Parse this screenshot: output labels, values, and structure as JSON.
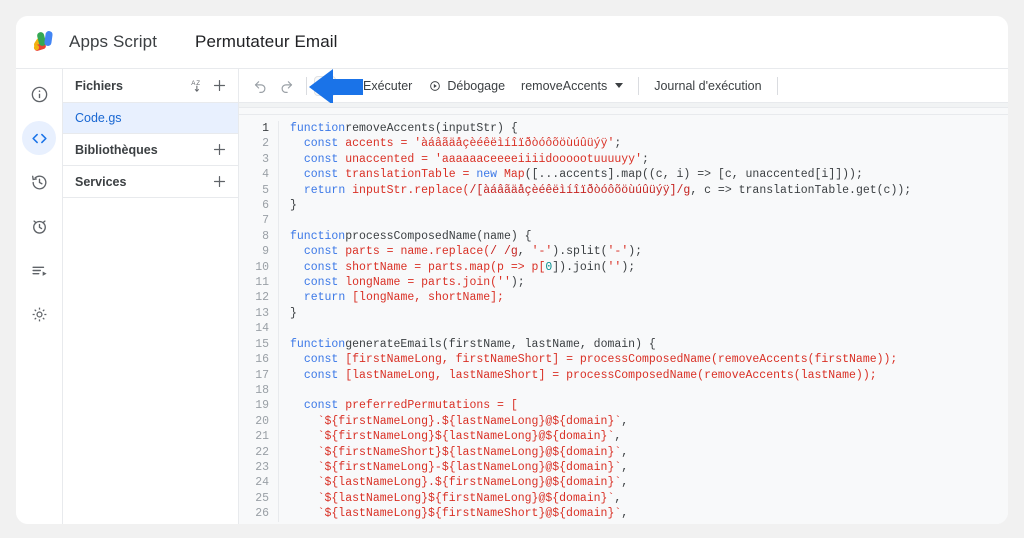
{
  "header": {
    "logo_icon": "apps-script-logo",
    "app_name": "Apps Script",
    "project_title": "Permutateur Email"
  },
  "rail": {
    "items": [
      {
        "icon": "info-icon",
        "label": "Présentation"
      },
      {
        "icon": "code-icon",
        "label": "Éditeur"
      },
      {
        "icon": "history-icon",
        "label": "Historique"
      },
      {
        "icon": "alarm-clock-icon",
        "label": "Déclencheurs"
      },
      {
        "icon": "executions-list-icon",
        "label": "Exécutions"
      },
      {
        "icon": "gear-icon",
        "label": "Paramètres du projet"
      }
    ],
    "active_index": 1
  },
  "files_panel": {
    "sections": [
      {
        "label": "Fichiers",
        "sort_icon": "sort-az-icon",
        "add_icon": "plus-icon"
      },
      {
        "label": "Bibliothèques",
        "add_icon": "plus-icon"
      },
      {
        "label": "Services",
        "add_icon": "plus-icon"
      }
    ],
    "files": [
      {
        "name": "Code.gs",
        "selected": true
      }
    ]
  },
  "toolbar": {
    "undo_icon": "undo-icon",
    "redo_icon": "redo-icon",
    "save_icon": "save-floppy-icon",
    "run_label": "Exécuter",
    "run_icon": "play-icon",
    "debug_label": "Débogage",
    "debug_icon": "debug-icon",
    "function_selector": "removeAccents",
    "log_label": "Journal d'exécution",
    "annotation_arrow": "left-arrow-annotation",
    "annotation_color": "#1a73e8"
  },
  "code": {
    "language": "javascript",
    "first_line": 1,
    "last_line": 26,
    "lines": [
      {
        "n": 1,
        "tokens": [
          [
            "kw",
            "function"
          ],
          [
            "",
            ""
          ],
          [
            "fn",
            "removeAccents"
          ],
          [
            "",
            "(inputStr) {"
          ]
        ]
      },
      {
        "n": 2,
        "tokens": [
          [
            "",
            "  "
          ],
          [
            "kw",
            "const"
          ],
          [
            "at",
            " accents = "
          ],
          [
            "str",
            "'àáâãäåçèéêëìíîïðòóôõöùúûüýÿ'"
          ],
          [
            "",
            ";"
          ]
        ]
      },
      {
        "n": 3,
        "tokens": [
          [
            "",
            "  "
          ],
          [
            "kw",
            "const"
          ],
          [
            "at",
            " unaccented = "
          ],
          [
            "str",
            "'aaaaaaceeeeiiiidoooootuuuuyy'"
          ],
          [
            "",
            ";"
          ]
        ]
      },
      {
        "n": 4,
        "tokens": [
          [
            "",
            "  "
          ],
          [
            "kw",
            "const"
          ],
          [
            "at",
            " translationTable = "
          ],
          [
            "kw",
            "new"
          ],
          [
            "cls",
            " Map"
          ],
          [
            "",
            "([...accents].map((c, i) => [c, unaccented[i]]));"
          ]
        ]
      },
      {
        "n": 5,
        "tokens": [
          [
            "",
            "  "
          ],
          [
            "kw",
            "return"
          ],
          [
            "at",
            " inputStr.replace("
          ],
          [
            "re",
            "/[àáâãäåçèéêëìíîïðòóôõöùúûüýÿ]/g"
          ],
          [
            "",
            ", c => translationTable.get(c));"
          ]
        ]
      },
      {
        "n": 6,
        "tokens": [
          [
            "",
            "}"
          ]
        ]
      },
      {
        "n": 7,
        "tokens": [
          [
            "",
            ""
          ]
        ]
      },
      {
        "n": 8,
        "tokens": [
          [
            "kw",
            "function"
          ],
          [
            "",
            ""
          ],
          [
            "fn",
            "processComposedName"
          ],
          [
            "",
            "(name) {"
          ]
        ]
      },
      {
        "n": 9,
        "tokens": [
          [
            "",
            "  "
          ],
          [
            "kw",
            "const"
          ],
          [
            "at",
            " parts = name.replace("
          ],
          [
            "re",
            "/ /g"
          ],
          [
            "",
            ", "
          ],
          [
            "str",
            "'-'"
          ],
          [
            "",
            ").split("
          ],
          [
            "str",
            "'-'"
          ],
          [
            "",
            ");"
          ]
        ]
      },
      {
        "n": 10,
        "tokens": [
          [
            "",
            "  "
          ],
          [
            "kw",
            "const"
          ],
          [
            "at",
            " shortName = parts.map(p => p["
          ],
          [
            "num",
            "0"
          ],
          [
            "",
            "]).join("
          ],
          [
            "str",
            "''"
          ],
          [
            "",
            ");"
          ]
        ]
      },
      {
        "n": 11,
        "tokens": [
          [
            "",
            "  "
          ],
          [
            "kw",
            "const"
          ],
          [
            "at",
            " longName = parts.join("
          ],
          [
            "str",
            "''"
          ],
          [
            "",
            ");"
          ]
        ]
      },
      {
        "n": 12,
        "tokens": [
          [
            "",
            "  "
          ],
          [
            "kw",
            "return"
          ],
          [
            "at",
            " [longName, shortName];"
          ]
        ]
      },
      {
        "n": 13,
        "tokens": [
          [
            "",
            "}"
          ]
        ]
      },
      {
        "n": 14,
        "tokens": [
          [
            "",
            ""
          ]
        ]
      },
      {
        "n": 15,
        "tokens": [
          [
            "kw",
            "function"
          ],
          [
            "",
            ""
          ],
          [
            "fn",
            "generateEmails"
          ],
          [
            "",
            "(firstName, lastName, domain) {"
          ]
        ]
      },
      {
        "n": 16,
        "tokens": [
          [
            "",
            "  "
          ],
          [
            "kw",
            "const"
          ],
          [
            "at",
            " [firstNameLong, firstNameShort] = processComposedName(removeAccents(firstName));"
          ]
        ]
      },
      {
        "n": 17,
        "tokens": [
          [
            "",
            "  "
          ],
          [
            "kw",
            "const"
          ],
          [
            "at",
            " [lastNameLong, lastNameShort] = processComposedName(removeAccents(lastName));"
          ]
        ]
      },
      {
        "n": 18,
        "tokens": [
          [
            "",
            ""
          ]
        ]
      },
      {
        "n": 19,
        "tokens": [
          [
            "",
            "  "
          ],
          [
            "kw",
            "const"
          ],
          [
            "at",
            " preferredPermutations = ["
          ]
        ]
      },
      {
        "n": 20,
        "tokens": [
          [
            "str",
            "    `${firstNameLong}.${lastNameLong}@${domain}`"
          ],
          [
            "",
            ","
          ]
        ]
      },
      {
        "n": 21,
        "tokens": [
          [
            "str",
            "    `${firstNameLong}${lastNameLong}@${domain}`"
          ],
          [
            "",
            ","
          ]
        ]
      },
      {
        "n": 22,
        "tokens": [
          [
            "str",
            "    `${firstNameShort}${lastNameLong}@${domain}`"
          ],
          [
            "",
            ","
          ]
        ]
      },
      {
        "n": 23,
        "tokens": [
          [
            "str",
            "    `${firstNameLong}-${lastNameLong}@${domain}`"
          ],
          [
            "",
            ","
          ]
        ]
      },
      {
        "n": 24,
        "tokens": [
          [
            "str",
            "    `${lastNameLong}.${firstNameLong}@${domain}`"
          ],
          [
            "",
            ","
          ]
        ]
      },
      {
        "n": 25,
        "tokens": [
          [
            "str",
            "    `${lastNameLong}${firstNameLong}@${domain}`"
          ],
          [
            "",
            ","
          ]
        ]
      },
      {
        "n": 26,
        "tokens": [
          [
            "str",
            "    `${lastNameLong}${firstNameShort}@${domain}`"
          ],
          [
            "",
            ","
          ]
        ]
      }
    ]
  },
  "colors": {
    "accent": "#1a73e8",
    "selected_row": "#e8f0fe",
    "editor_bg": "#f8f9fa",
    "page_bg": "#f1f1f1"
  }
}
